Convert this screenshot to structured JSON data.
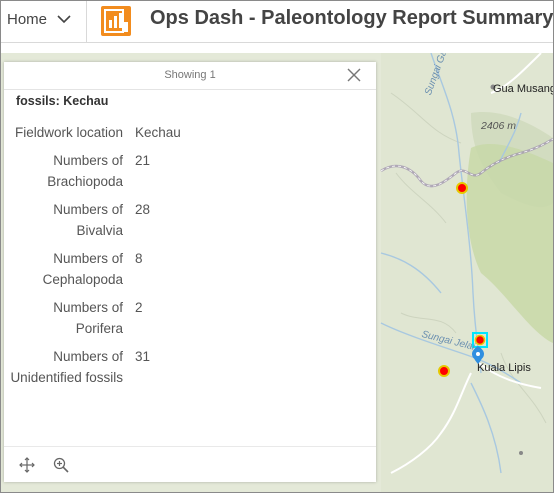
{
  "header": {
    "home_label": "Home",
    "title": "Ops Dash - Paleontology Report Summary"
  },
  "map": {
    "labels": {
      "gua_musang": "Gua Musang",
      "elevation": "2406 m",
      "sungai_galas": "Sungai Galas",
      "sungai_jelai": "Sungai Jelai",
      "kuala_lipis": "Kuala Lipis"
    },
    "colors": {
      "fossil_point": "#ff0000",
      "fossil_point_outline": "#e6c800",
      "selection": "#00e5ff",
      "location_pin": "#2f8fe0",
      "forest": "#c8d8a8",
      "water": "#a8c8e0"
    }
  },
  "popup": {
    "showing": "Showing 1",
    "title": "fossils: Kechau",
    "fields": [
      {
        "name": "Fieldwork location",
        "value": "Kechau"
      },
      {
        "name": "Numbers of Brachiopoda",
        "value": "21"
      },
      {
        "name": "Numbers of Bivalvia",
        "value": "28"
      },
      {
        "name": "Numbers of Cephalopoda",
        "value": "8"
      },
      {
        "name": "Numbers of Porifera",
        "value": "2"
      },
      {
        "name": "Numbers of Unidentified fossils",
        "value": "31"
      }
    ],
    "footer_icons": [
      "pan-icon",
      "zoom-to-icon"
    ]
  }
}
